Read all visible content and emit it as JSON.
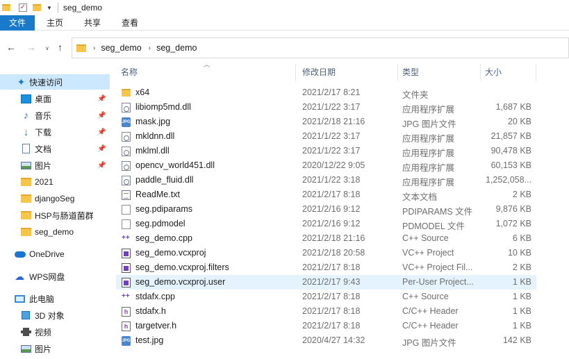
{
  "window": {
    "title": "seg_demo"
  },
  "ribbon": {
    "tabs": [
      "文件",
      "主页",
      "共享",
      "查看"
    ]
  },
  "address": {
    "segments": [
      "seg_demo",
      "seg_demo"
    ]
  },
  "sidebar": {
    "items": [
      {
        "label": "快速访问",
        "icon": "star-icon",
        "pinned": false
      },
      {
        "label": "桌面",
        "icon": "desktop-icon",
        "pinned": true
      },
      {
        "label": "音乐",
        "icon": "music-icon",
        "pinned": true
      },
      {
        "label": "下载",
        "icon": "download-icon",
        "pinned": true
      },
      {
        "label": "文档",
        "icon": "document-icon",
        "pinned": true
      },
      {
        "label": "图片",
        "icon": "pictures-icon",
        "pinned": true
      },
      {
        "label": "2021",
        "icon": "folder-icon",
        "pinned": false
      },
      {
        "label": "djangoSeg",
        "icon": "folder-icon",
        "pinned": false
      },
      {
        "label": "HSP与肠道菌群",
        "icon": "folder-icon",
        "pinned": false
      },
      {
        "label": "seg_demo",
        "icon": "folder-icon",
        "pinned": false
      },
      {
        "label": "OneDrive",
        "icon": "cloud-icon",
        "pinned": false
      },
      {
        "label": "WPS网盘",
        "icon": "wps-cloud-icon",
        "pinned": false
      },
      {
        "label": "此电脑",
        "icon": "computer-icon",
        "pinned": false
      },
      {
        "label": "3D 对象",
        "icon": "3d-objects-icon",
        "pinned": false
      },
      {
        "label": "视频",
        "icon": "video-icon",
        "pinned": false
      },
      {
        "label": "图片",
        "icon": "pictures-icon",
        "pinned": false
      }
    ]
  },
  "columns": {
    "name": "名称",
    "date": "修改日期",
    "type": "类型",
    "size": "大小"
  },
  "files": [
    {
      "name": "x64",
      "date": "2021/2/17 8:21",
      "type": "文件夹",
      "size": "",
      "icon": "folder-icon"
    },
    {
      "name": "libiomp5md.dll",
      "date": "2021/1/22 3:17",
      "type": "应用程序扩展",
      "size": "1,687 KB",
      "icon": "dll-icon"
    },
    {
      "name": "mask.jpg",
      "date": "2021/2/18 21:16",
      "type": "JPG 图片文件",
      "size": "20 KB",
      "icon": "jpg-icon"
    },
    {
      "name": "mkldnn.dll",
      "date": "2021/1/22 3:17",
      "type": "应用程序扩展",
      "size": "21,857 KB",
      "icon": "dll-icon"
    },
    {
      "name": "mklml.dll",
      "date": "2021/1/22 3:17",
      "type": "应用程序扩展",
      "size": "90,478 KB",
      "icon": "dll-icon"
    },
    {
      "name": "opencv_world451.dll",
      "date": "2020/12/22 9:05",
      "type": "应用程序扩展",
      "size": "60,153 KB",
      "icon": "dll-icon"
    },
    {
      "name": "paddle_fluid.dll",
      "date": "2021/1/22 3:18",
      "type": "应用程序扩展",
      "size": "1,252,058...",
      "icon": "dll-icon"
    },
    {
      "name": "ReadMe.txt",
      "date": "2021/2/17 8:18",
      "type": "文本文档",
      "size": "2 KB",
      "icon": "text-file-icon"
    },
    {
      "name": "seg.pdiparams",
      "date": "2021/2/16 9:12",
      "type": "PDIPARAMS 文件",
      "size": "9,876 KB",
      "icon": "blank-file-icon"
    },
    {
      "name": "seg.pdmodel",
      "date": "2021/2/16 9:12",
      "type": "PDMODEL 文件",
      "size": "1,072 KB",
      "icon": "blank-file-icon"
    },
    {
      "name": "seg_demo.cpp",
      "date": "2021/2/18 21:16",
      "type": "C++ Source",
      "size": "6 KB",
      "icon": "cpp-icon"
    },
    {
      "name": "seg_demo.vcxproj",
      "date": "2021/2/18 20:58",
      "type": "VC++ Project",
      "size": "10 KB",
      "icon": "vcxproj-icon"
    },
    {
      "name": "seg_demo.vcxproj.filters",
      "date": "2021/2/17 8:18",
      "type": "VC++ Project Fil...",
      "size": "2 KB",
      "icon": "vcxproj-icon"
    },
    {
      "name": "seg_demo.vcxproj.user",
      "date": "2021/2/17 9:43",
      "type": "Per-User Project...",
      "size": "1 KB",
      "icon": "vcxproj-icon",
      "hover": true
    },
    {
      "name": "stdafx.cpp",
      "date": "2021/2/17 8:18",
      "type": "C++ Source",
      "size": "1 KB",
      "icon": "cpp-icon"
    },
    {
      "name": "stdafx.h",
      "date": "2021/2/17 8:18",
      "type": "C/C++ Header",
      "size": "1 KB",
      "icon": "header-icon"
    },
    {
      "name": "targetver.h",
      "date": "2021/2/17 8:18",
      "type": "C/C++ Header",
      "size": "1 KB",
      "icon": "header-icon"
    },
    {
      "name": "test.jpg",
      "date": "2020/4/27 14:32",
      "type": "JPG 图片文件",
      "size": "142 KB",
      "icon": "jpg-icon"
    }
  ]
}
